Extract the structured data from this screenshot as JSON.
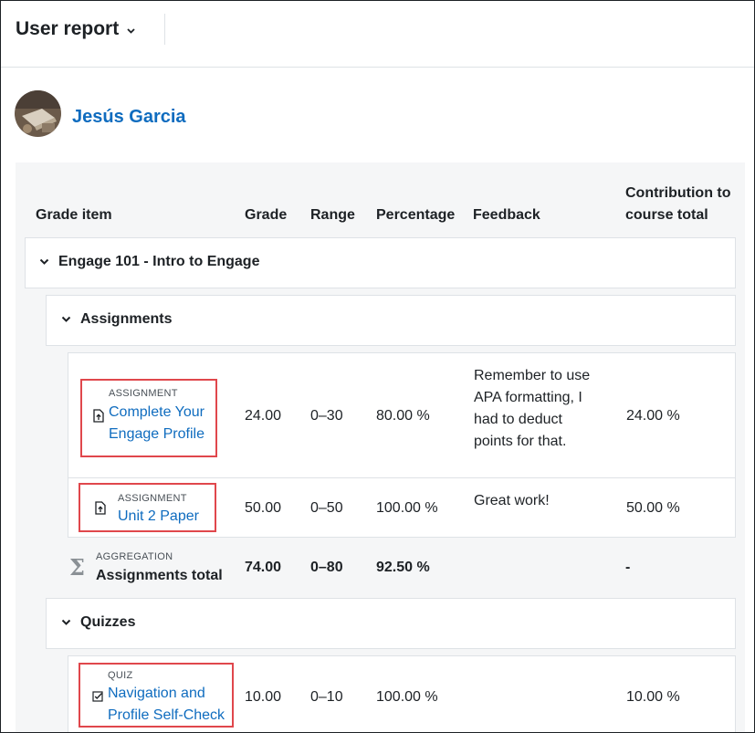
{
  "header": {
    "report_title": "User report"
  },
  "user": {
    "name": "Jesús Garcia"
  },
  "columns": {
    "grade_item": "Grade item",
    "grade": "Grade",
    "range": "Range",
    "percentage": "Percentage",
    "feedback": "Feedback",
    "contribution_line1": "Contribution to",
    "contribution_line2": "course total"
  },
  "course": {
    "name": "Engage 101 - Intro to Engage"
  },
  "assignments": {
    "category": "Assignments",
    "items": [
      {
        "type": "ASSIGNMENT",
        "name_line1": "Complete Your",
        "name_line2": "Engage Profile",
        "grade": "24.00",
        "range": "0–30",
        "percentage": "80.00 %",
        "feedback": [
          "Remember to use",
          "APA formatting, I",
          "had to deduct",
          "points for that."
        ],
        "contribution": "24.00 %"
      },
      {
        "type": "ASSIGNMENT",
        "name": "Unit 2 Paper",
        "grade": "50.00",
        "range": "0–50",
        "percentage": "100.00 %",
        "feedback": "Great work!",
        "contribution": "50.00 %"
      }
    ],
    "total": {
      "type": "AGGREGATION",
      "name": "Assignments total",
      "grade": "74.00",
      "range": "0–80",
      "percentage": "92.50 %",
      "contribution": "-"
    }
  },
  "quizzes": {
    "category": "Quizzes",
    "items": [
      {
        "type": "QUIZ",
        "name_line1": "Navigation and",
        "name_line2": "Profile Self-Check",
        "grade": "10.00",
        "range": "0–10",
        "percentage": "100.00 %",
        "contribution": "10.00 %"
      }
    ]
  },
  "colors": {
    "link": "#0f6cbf",
    "highlight": "#e0474c",
    "panel_bg": "#f5f6f7"
  }
}
